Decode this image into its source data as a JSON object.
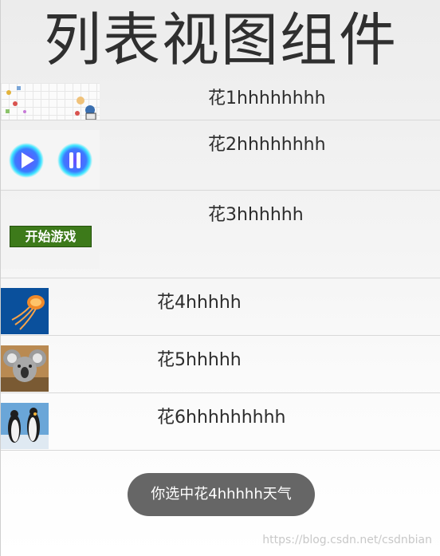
{
  "header": {
    "title": "列表视图组件"
  },
  "list": {
    "items": [
      {
        "label": "花1hhhhhhhh",
        "thumbnail": "sketch-grid-image"
      },
      {
        "label": "花2hhhhhhhh",
        "thumbnail": "play-pause-buttons-image"
      },
      {
        "label": "花3hhhhhh",
        "thumbnail": "start-game-banner-image",
        "banner_text": "开始游戏"
      },
      {
        "label": "花4hhhhh",
        "thumbnail": "jellyfish-photo"
      },
      {
        "label": "花5hhhhh",
        "thumbnail": "koala-photo"
      },
      {
        "label": "花6hhhhhhhhh",
        "thumbnail": "penguins-photo"
      }
    ]
  },
  "toast": {
    "text": "你选中花4hhhhh天气"
  },
  "watermark": {
    "text": "https://blog.csdn.net/csdnbian"
  },
  "colors": {
    "background": "#f2f2f2",
    "divider": "#d8d8d8",
    "toast_bg": "#666666",
    "banner_green": "#3d7a1a"
  }
}
